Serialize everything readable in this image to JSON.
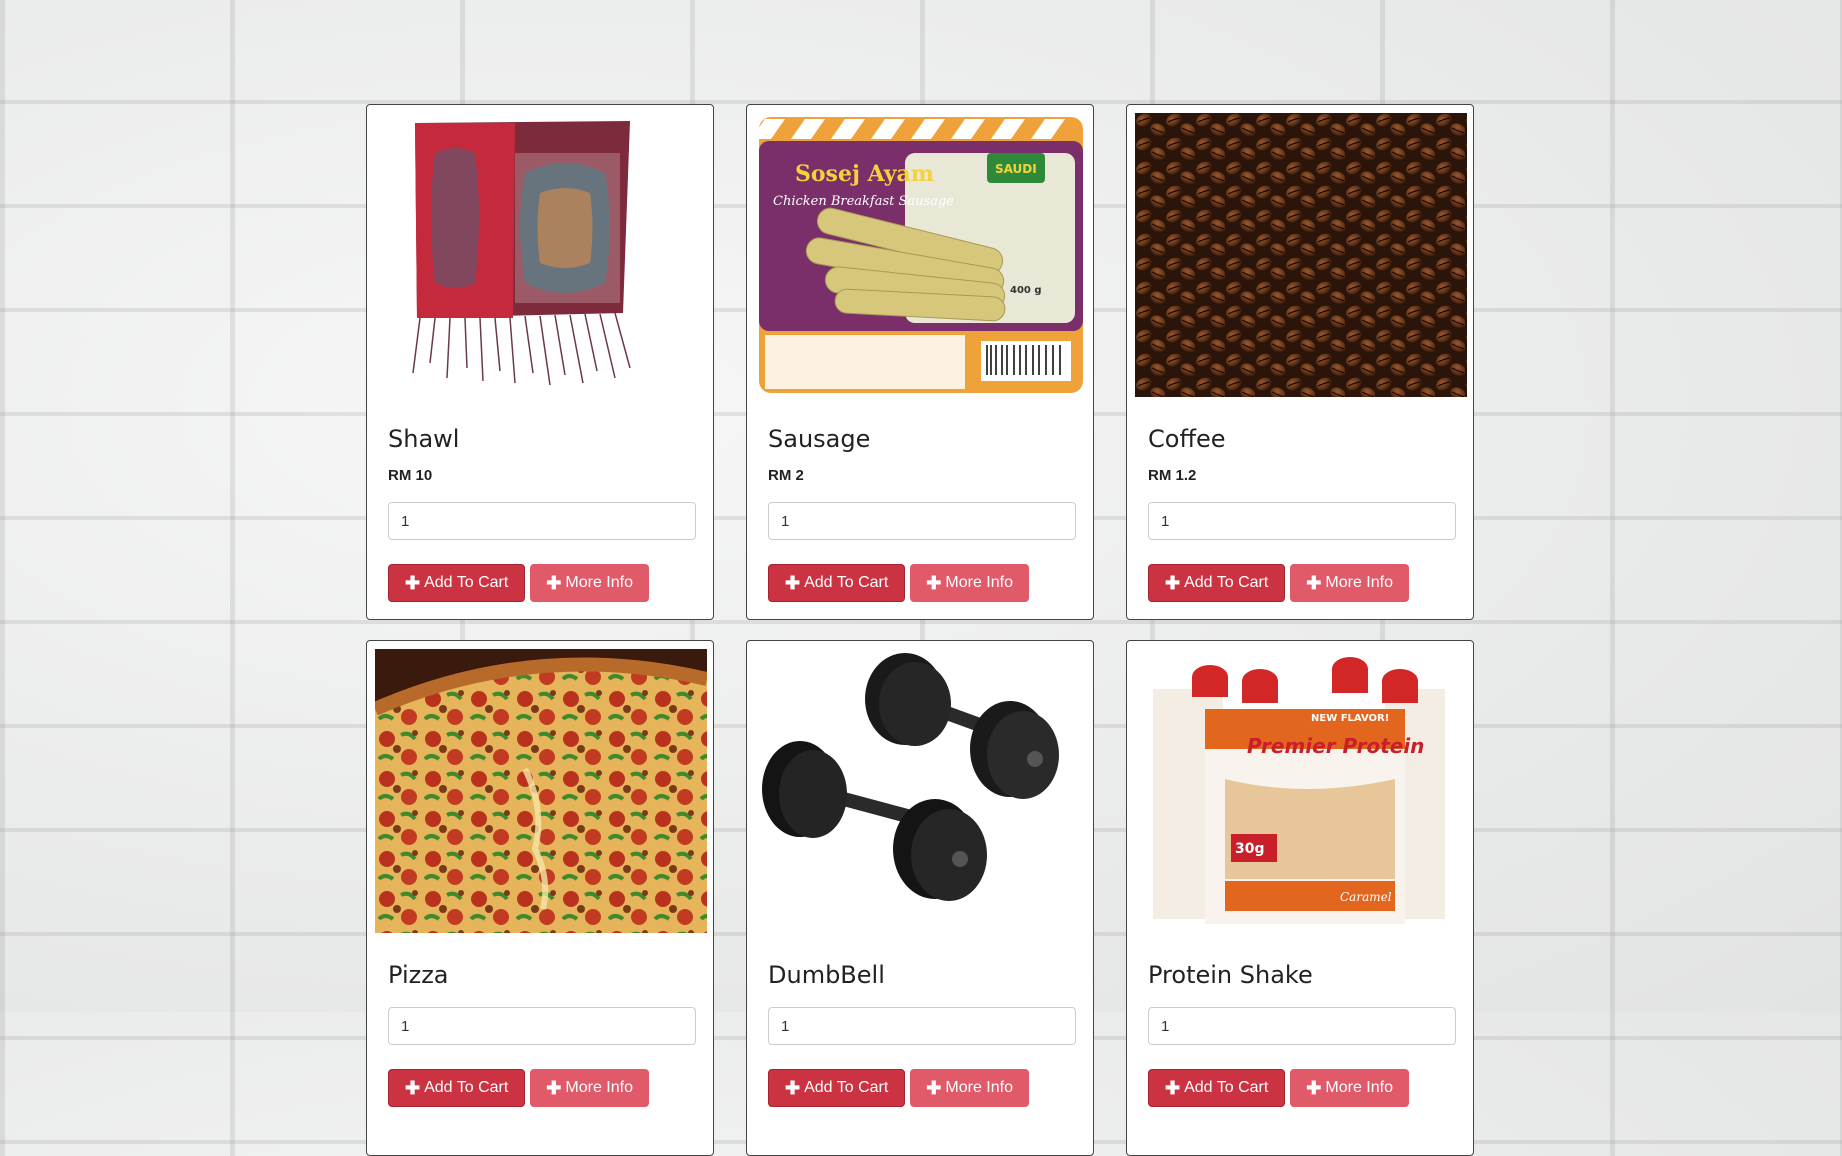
{
  "products": [
    {
      "name": "Shawl",
      "price": "RM 10",
      "qty": "1",
      "add_label": "Add To Cart",
      "info_label": "More Info"
    },
    {
      "name": "Sausage",
      "price": "RM 2",
      "qty": "1",
      "add_label": "Add To Cart",
      "info_label": "More Info"
    },
    {
      "name": "Coffee",
      "price": "RM 1.2",
      "qty": "1",
      "add_label": "Add To Cart",
      "info_label": "More Info"
    },
    {
      "name": "Pizza",
      "price": "",
      "qty": "1",
      "add_label": "Add To Cart",
      "info_label": "More Info"
    },
    {
      "name": "DumbBell",
      "price": "",
      "qty": "1",
      "add_label": "Add To Cart",
      "info_label": "More Info"
    },
    {
      "name": "Protein Shake",
      "price": "",
      "qty": "1",
      "add_label": "Add To Cart",
      "info_label": "More Info"
    }
  ],
  "image_text": {
    "sausage_brand": "Sosej Ayam",
    "sausage_sub": "Chicken Breakfast Sausage",
    "sausage_logo": "SAUDI",
    "sausage_weight": "400 g",
    "protein_brand": "Premier Protein",
    "protein_flag": "NEW FLAVOR!",
    "protein_grams": "30g",
    "protein_flavor": "Caramel"
  },
  "colors": {
    "primary": "#cc3342",
    "secondary": "#e05a6a"
  }
}
